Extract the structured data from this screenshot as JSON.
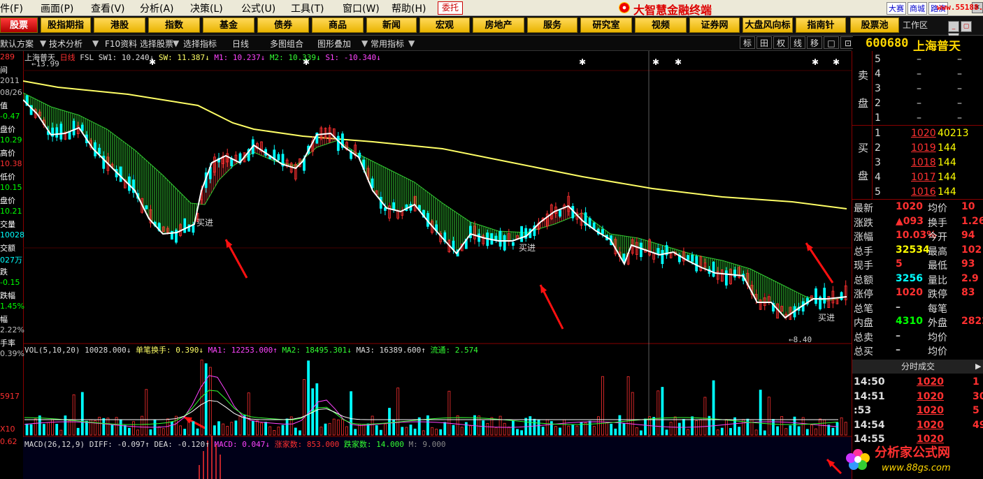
{
  "menu": [
    "件(F)",
    "画面(P)",
    "查看(V)",
    "分析(A)",
    "决策(L)",
    "公式(U)",
    "工具(T)",
    "窗口(W)",
    "帮助(H)"
  ],
  "entrust_btn": "委托",
  "brand": "大智慧金融终端",
  "quick_links": [
    "大赛",
    "商城",
    "路演"
  ],
  "site": "www.55188.com",
  "categories": [
    "股票",
    "股指期指",
    "港股",
    "指数",
    "基金",
    "债券",
    "商品",
    "新闻",
    "宏观",
    "房地产",
    "服务",
    "研究室",
    "视频",
    "证券网",
    "大盘风向标",
    "指南针",
    "股票池"
  ],
  "workzone": "工作区",
  "toolbar": [
    "默认方案",
    "技术分析",
    "F10资料",
    "选择股票",
    "选择指标",
    "日线",
    "多图组合",
    "图形叠加",
    "常用指标"
  ],
  "right_toolbar": [
    "标",
    "田",
    "权",
    "线",
    "移",
    "□",
    "⊡"
  ],
  "stock": {
    "code": "600680",
    "name": "上海普天"
  },
  "chart_title": {
    "name": "上海普天",
    "period": "日线",
    "indicator": "FSL",
    "sw1": "SW1: 10.240↓",
    "sw": "SW: 11.387↓",
    "m1": "M1: 10.237↓",
    "m2": "M2: 10.339↓",
    "s1": "S1: -10.340↓"
  },
  "left_axis": [
    {
      "t": "289",
      "c": "#ff3030"
    },
    {
      "t": "间",
      "c": "#ffffff"
    },
    {
      "t": "2011",
      "c": "#c0c0c0"
    },
    {
      "t": "08/26",
      "c": "#c0c0c0"
    },
    {
      "t": "值",
      "c": "#ffffff"
    },
    {
      "t": "-0.47",
      "c": "#00ff00"
    },
    {
      "t": "盘价",
      "c": "#ffffff"
    },
    {
      "t": "10.29",
      "c": "#00ff00"
    },
    {
      "t": "高价",
      "c": "#ffffff"
    },
    {
      "t": "10.38",
      "c": "#ff3030"
    },
    {
      "t": "低价",
      "c": "#ffffff"
    },
    {
      "t": "10.15",
      "c": "#00ff00"
    },
    {
      "t": "盘价",
      "c": "#ffffff"
    },
    {
      "t": "10.21",
      "c": "#00ff00"
    },
    {
      "t": "交量",
      "c": "#ffffff"
    },
    {
      "t": "10028",
      "c": "#00ffff"
    },
    {
      "t": "交额",
      "c": "#ffffff"
    },
    {
      "t": "027万",
      "c": "#00ffff"
    },
    {
      "t": "跌",
      "c": "#ffffff"
    },
    {
      "t": "-0.15",
      "c": "#00ff00"
    },
    {
      "t": "跌幅",
      "c": "#ffffff"
    },
    {
      "t": "1.45%",
      "c": "#00ff00"
    },
    {
      "t": "幅",
      "c": "#ffffff"
    },
    {
      "t": "2.22%",
      "c": "#c0c0c0"
    },
    {
      "t": "手率",
      "c": "#ffffff"
    },
    {
      "t": "0.39%",
      "c": "#c0c0c0"
    }
  ],
  "left_axis_extra": [
    {
      "t": "5917",
      "c": "#ff3030"
    },
    {
      "t": "X10",
      "c": "#ff3030"
    },
    {
      "t": "0.62",
      "c": "#ff3030"
    }
  ],
  "price_labels": {
    "high": "13.99",
    "low": "8.40"
  },
  "annotations": [
    "买进",
    "买进",
    "买进"
  ],
  "vol_legend": {
    "name": "VOL(5,10,20)",
    "val": "10028.000↓",
    "turn": "单笔换手: 0.390↓",
    "ma1": "MA1: 12253.000↑",
    "ma2": "MA2: 18495.301↓",
    "ma3": "MA3: 16389.600↑",
    "flow": "流通: 2.574"
  },
  "macd_legend": {
    "name": "MACD(26,12,9)",
    "diff": "DIFF: -0.097↑",
    "dea": "DEA: -0.120↑",
    "macd": "MACD: 0.047↓",
    "up": "涨家数: 853.000",
    "down": "跌家数: 14.000",
    "m": "M: 9.000"
  },
  "order_book": {
    "sell_label": [
      "卖",
      "盘"
    ],
    "buy_label": [
      "买",
      "盘"
    ],
    "sell": [
      {
        "lvl": "5",
        "p": "–",
        "v": "–"
      },
      {
        "lvl": "4",
        "p": "–",
        "v": "–"
      },
      {
        "lvl": "3",
        "p": "–",
        "v": "–"
      },
      {
        "lvl": "2",
        "p": "–",
        "v": "–"
      },
      {
        "lvl": "1",
        "p": "–",
        "v": "–"
      }
    ],
    "buy": [
      {
        "lvl": "1",
        "p": "1020",
        "v": "40213"
      },
      {
        "lvl": "2",
        "p": "1019",
        "v": "144"
      },
      {
        "lvl": "3",
        "p": "1018",
        "v": "144"
      },
      {
        "lvl": "4",
        "p": "1017",
        "v": "144"
      },
      {
        "lvl": "5",
        "p": "1016",
        "v": "144"
      }
    ]
  },
  "quote": [
    {
      "l1": "最新",
      "v1": "1020",
      "c1": "#ff3030",
      "l2": "均价",
      "v2": "10"
    },
    {
      "l1": "涨跌",
      "v1": "▲093",
      "c1": "#ff3030",
      "l2": "换手",
      "v2": "1.26"
    },
    {
      "l1": "涨幅",
      "v1": "10.03%",
      "c1": "#ff3030",
      "l2": "今开",
      "v2": "94"
    },
    {
      "l1": "总手",
      "v1": "32534",
      "c1": "#ffff00",
      "l2": "最高",
      "v2": "102"
    },
    {
      "l1": "现手",
      "v1": "5",
      "c1": "#ff3030",
      "l2": "最低",
      "v2": "93"
    },
    {
      "l1": "总额",
      "v1": "3256",
      "c1": "#00ffff",
      "l2": "量比",
      "v2": "2.9"
    },
    {
      "l1": "涨停",
      "v1": "1020",
      "c1": "#ff3030",
      "l2": "跌停",
      "v2": "83"
    },
    {
      "l1": "总笔",
      "v1": "–",
      "c1": "#c0c0c0",
      "l2": "每笔",
      "v2": ""
    },
    {
      "l1": "内盘",
      "v1": "4310",
      "c1": "#00ff00",
      "l2": "外盘",
      "v2": "2822"
    },
    {
      "l1": "总卖",
      "v1": "–",
      "c1": "#c0c0c0",
      "l2": "均价",
      "v2": ""
    },
    {
      "l1": "总买",
      "v1": "–",
      "c1": "#c0c0c0",
      "l2": "均价",
      "v2": ""
    }
  ],
  "trades_header": "分时成交",
  "trades": [
    {
      "t": "14:50",
      "p": "1020",
      "v": "1"
    },
    {
      "t": "14:51",
      "p": "1020",
      "v": "30"
    },
    {
      "t": ":53",
      "p": "1020",
      "v": "5"
    },
    {
      "t": "14:54",
      "p": "1020",
      "v": "49"
    },
    {
      "t": "14:55",
      "p": "1020",
      "v": ""
    }
  ],
  "watermark": {
    "text": "分析家公式网",
    "url": "www.88gs.com"
  },
  "colors": {
    "up": "#ff3030",
    "down": "#00ffff",
    "ma_long": "#ffff66",
    "ma_short": "#ffffff",
    "fill_down": "#33cc33",
    "fill_up": "#cc3333"
  },
  "chart_data": {
    "type": "candlestick",
    "series": [
      {
        "name": "SW1",
        "values": [
          10.24
        ]
      },
      {
        "name": "SW",
        "values": [
          11.387
        ]
      },
      {
        "name": "M1",
        "values": [
          10.237
        ]
      },
      {
        "name": "M2",
        "values": [
          10.339
        ]
      },
      {
        "name": "S1",
        "values": [
          -10.34
        ]
      }
    ],
    "price_marks": {
      "high": 13.99,
      "low": 8.4
    },
    "volume": {
      "ma1": 12253.0,
      "ma2": 18495.301,
      "ma3": 16389.6,
      "last": 10028.0
    },
    "macd": {
      "diff": -0.097,
      "dea": -0.12,
      "macd": 0.047
    }
  }
}
